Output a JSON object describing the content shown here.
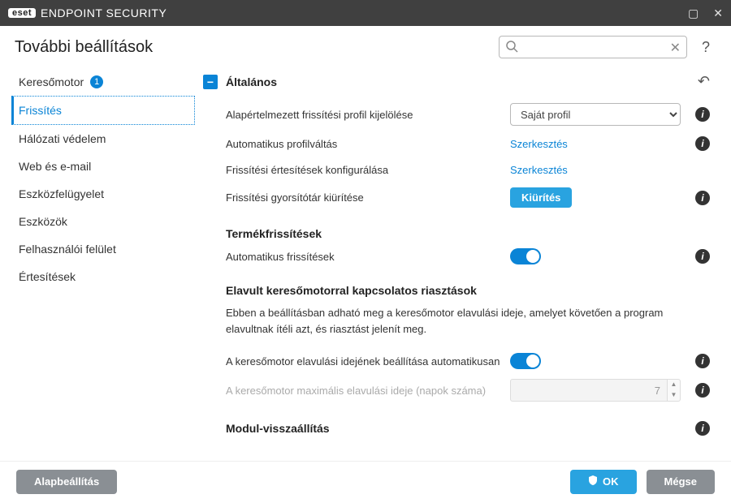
{
  "titlebar": {
    "brand_box": "eset",
    "brand_name": "ENDPOINT SECURITY"
  },
  "header": {
    "title": "További beállítások",
    "search_placeholder": ""
  },
  "sidebar": {
    "items": [
      {
        "label": "Keresőmotor",
        "badge": "1"
      },
      {
        "label": "Frissítés"
      },
      {
        "label": "Hálózati védelem"
      },
      {
        "label": "Web és e-mail"
      },
      {
        "label": "Eszközfelügyelet"
      },
      {
        "label": "Eszközök"
      },
      {
        "label": "Felhasználói felület"
      },
      {
        "label": "Értesítések"
      }
    ]
  },
  "main": {
    "section_title": "Általános",
    "rows": {
      "default_profile_label": "Alapértelmezett frissítési profil kijelölése",
      "default_profile_value": "Saját profil",
      "auto_profile_switch_label": "Automatikus profilváltás",
      "edit_link": "Szerkesztés",
      "notify_config_label": "Frissítési értesítések konfigurálása",
      "clear_cache_label": "Frissítési gyorsítótár kiürítése",
      "clear_cache_btn": "Kiürítés"
    },
    "product_updates": {
      "title": "Termékfrissítések",
      "auto_updates_label": "Automatikus frissítések"
    },
    "outdated": {
      "title": "Elavult keresőmotorral kapcsolatos riasztások",
      "desc": "Ebben a beállításban adható meg a keresőmotor elavulási ideje, amelyet követően a program elavultnak ítéli azt, és riasztást jelenít meg.",
      "auto_set_label": "A keresőmotor elavulási idejének beállítása automatikusan",
      "max_age_label": "A keresőmotor maximális elavulási ideje (napok száma)",
      "max_age_value": "7"
    },
    "module_rollback": {
      "title": "Modul-visszaállítás"
    }
  },
  "footer": {
    "default_btn": "Alapbeállítás",
    "ok_btn": "OK",
    "cancel_btn": "Mégse"
  }
}
